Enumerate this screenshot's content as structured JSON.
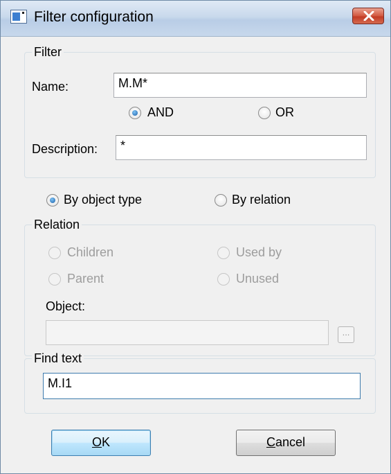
{
  "window": {
    "title": "Filter configuration"
  },
  "filter_group": {
    "legend": "Filter",
    "name_label": "Name:",
    "name_value": "M.M*",
    "and_label": "AND",
    "and_checked": true,
    "or_label": "OR",
    "or_checked": false,
    "description_label": "Description:",
    "description_value": "*"
  },
  "mode": {
    "by_object_type_label": "By object type",
    "by_object_type_checked": true,
    "by_relation_label": "By relation",
    "by_relation_checked": false
  },
  "relation_group": {
    "legend": "Relation",
    "children_label": "Children",
    "used_by_label": "Used by",
    "parent_label": "Parent",
    "unused_label": "Unused",
    "object_label": "Object:",
    "object_value": "",
    "browse_label": "...",
    "enabled": false
  },
  "find_group": {
    "legend": "Find text",
    "find_value": "M.I1"
  },
  "buttons": {
    "ok_label": "OK",
    "ok_mnemonic": "O",
    "ok_rest": "K",
    "cancel_label": "Cancel",
    "cancel_mnemonic": "C",
    "cancel_rest": "ancel"
  },
  "colors": {
    "accent": "#3d7bad",
    "close_button": "#c23a24",
    "disabled_text": "#9d9d9d"
  },
  "icons": {
    "app": "window-app-icon",
    "close": "close-x-icon"
  }
}
